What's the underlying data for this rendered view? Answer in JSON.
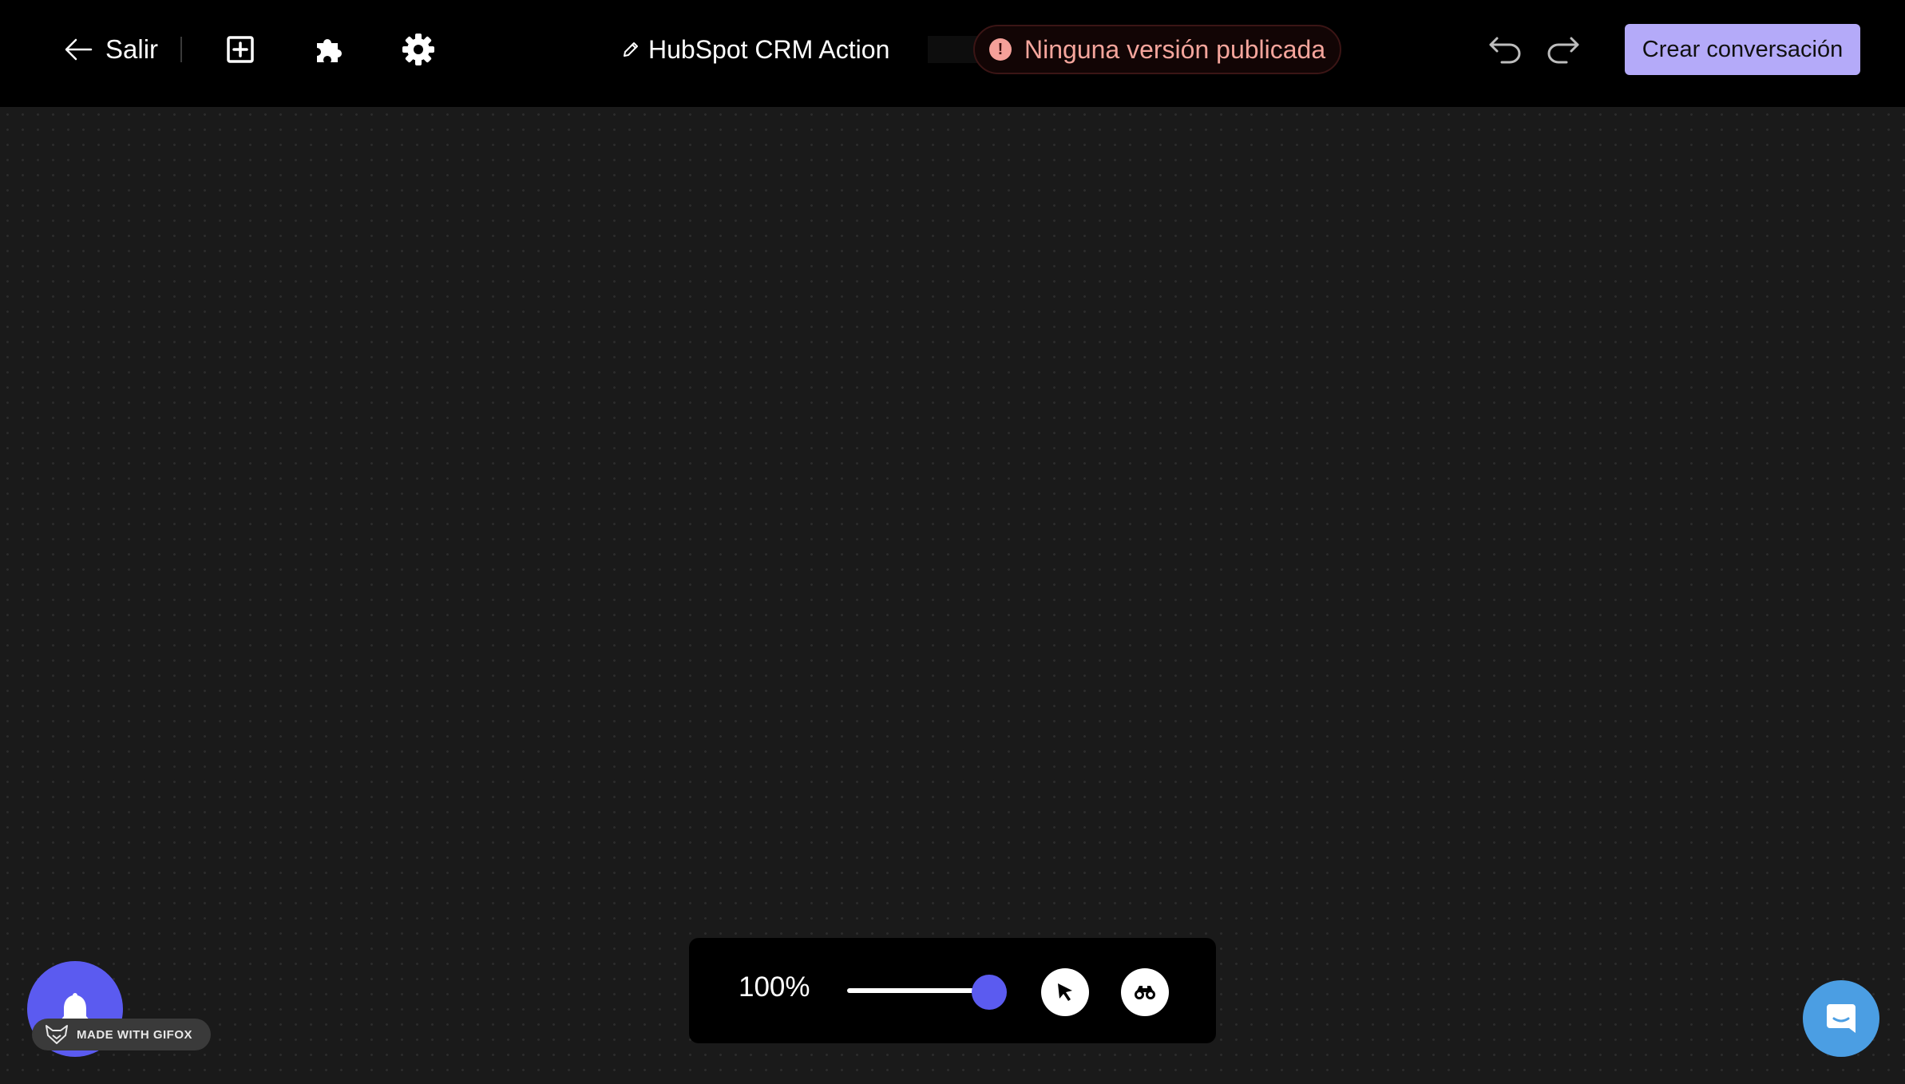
{
  "header": {
    "exit_label": "Salir",
    "title": "HubSpot CRM Action",
    "status": "Ninguna versión publicada",
    "create_button": "Crear conversación"
  },
  "icons": {
    "exit": "arrow-left-icon",
    "add": "add-square-icon",
    "plugins": "puzzle-icon",
    "settings": "gear-icon",
    "edit": "pencil-icon",
    "status": "alert-circle-icon",
    "undo": "undo-icon",
    "redo": "redo-icon",
    "select": "cursor-icon",
    "search": "binoculars-icon",
    "notifications": "bell-icon",
    "chat": "chat-icon"
  },
  "zoom": {
    "label": "100%",
    "slider_value": 1.0
  },
  "watermark": {
    "text": "MADE WITH GIFOX"
  },
  "colors": {
    "accent": "#5b5bf0",
    "primary_button": "#b4aaf9",
    "status_text": "#f5a59c",
    "chat_button": "#4b9ee3"
  }
}
